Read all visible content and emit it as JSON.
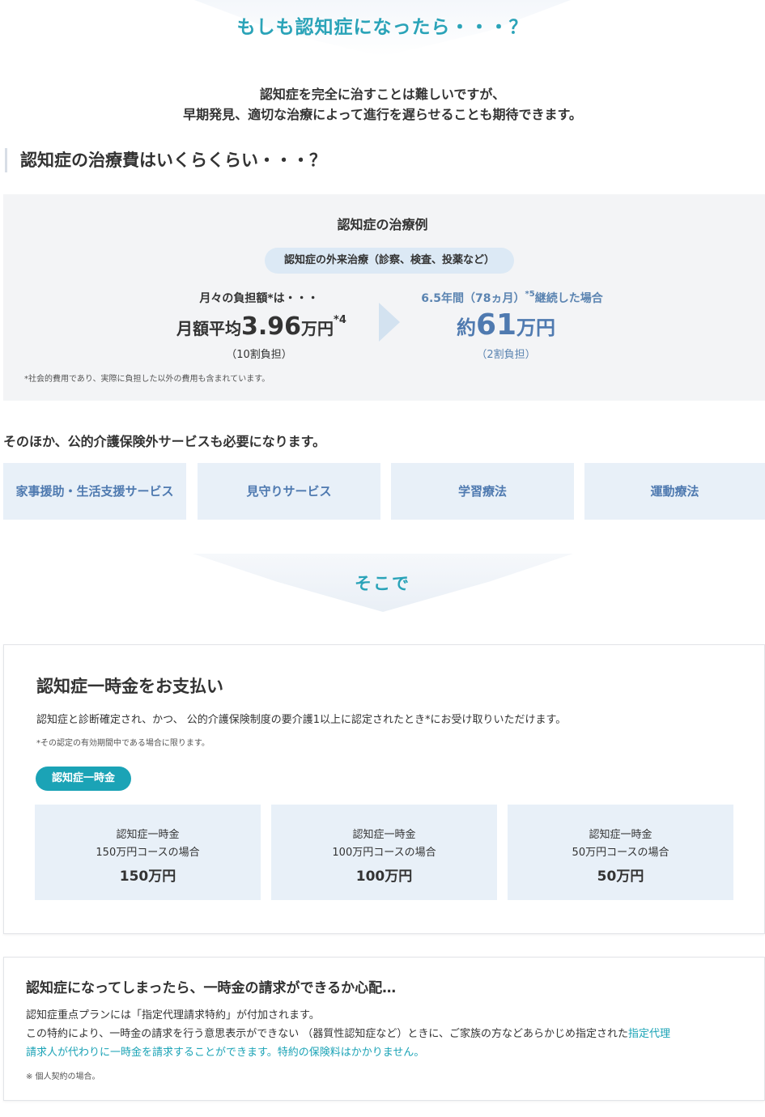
{
  "hero": {
    "title": "もしも認知症になったら・・・？"
  },
  "intro": {
    "line1": "認知症を完全に治すことは難しいですが、",
    "line2": "早期発見、適切な治療によって進行を遅らせることも期待できます。"
  },
  "cost_section": {
    "heading": "認知症の治療費はいくらくらい・・・？",
    "title": "認知症の治療例",
    "pill": "認知症の外来治療（診察、検査、投薬など）",
    "left": {
      "label": "月々の負担額*は・・・",
      "prefix": "月額平均",
      "amount": "3.96",
      "unit": "万円",
      "sup": "*4",
      "sub": "（10割負担）"
    },
    "right": {
      "label_main": "6.5年間（78ヵ月）",
      "label_sup": "*5",
      "label_tail": "継続した場合",
      "prefix": "約",
      "amount": "61",
      "unit": "万円",
      "sub": "（2割負担）"
    },
    "note": "*社会的費用であり、実際に負担した以外の費用も含まれています。"
  },
  "other_services": {
    "lead": "そのほか、公的介護保険外サービスも必要になります。",
    "items": [
      "家事援助・生活支援サービス",
      "見守りサービス",
      "学習療法",
      "運動療法"
    ]
  },
  "soko": {
    "label": "そこで"
  },
  "lump_sum": {
    "title": "認知症一時金をお支払い",
    "desc": "認知症と診断確定され、かつ、 公的介護保険制度の要介護1以上に認定されたとき*にお受け取りいただけます。",
    "note": "*その認定の有効期間中である場合に限ります。",
    "pill": "認知症一時金",
    "plans": [
      {
        "name": "認知症一時金",
        "course": "150万円コースの場合",
        "amount": "150万円"
      },
      {
        "name": "認知症一時金",
        "course": "100万円コースの場合",
        "amount": "100万円"
      },
      {
        "name": "認知症一時金",
        "course": "50万円コースの場合",
        "amount": "50万円"
      }
    ]
  },
  "proxy": {
    "title": "認知症になってしまったら、一時金の請求ができるか心配…",
    "line1": "認知症重点プランには「指定代理請求特約」が付加されます。",
    "line2_plain": "この特約により、一時金の請求を行う意思表示ができない （器質性認知症など）ときに、ご家族の方などあらかじめ指定された",
    "line2_hl": "指定代理",
    "line3_hl": "請求人が代わりに一時金を請求することができます。特約の保険料はかかりません。",
    "note": "※ 個人契約の場合。"
  },
  "colors": {
    "teal": "#2aa3b8",
    "blue": "#4f7ab0",
    "light_blue": "#e8f0f8",
    "gray_bg": "#f3f4f6"
  }
}
